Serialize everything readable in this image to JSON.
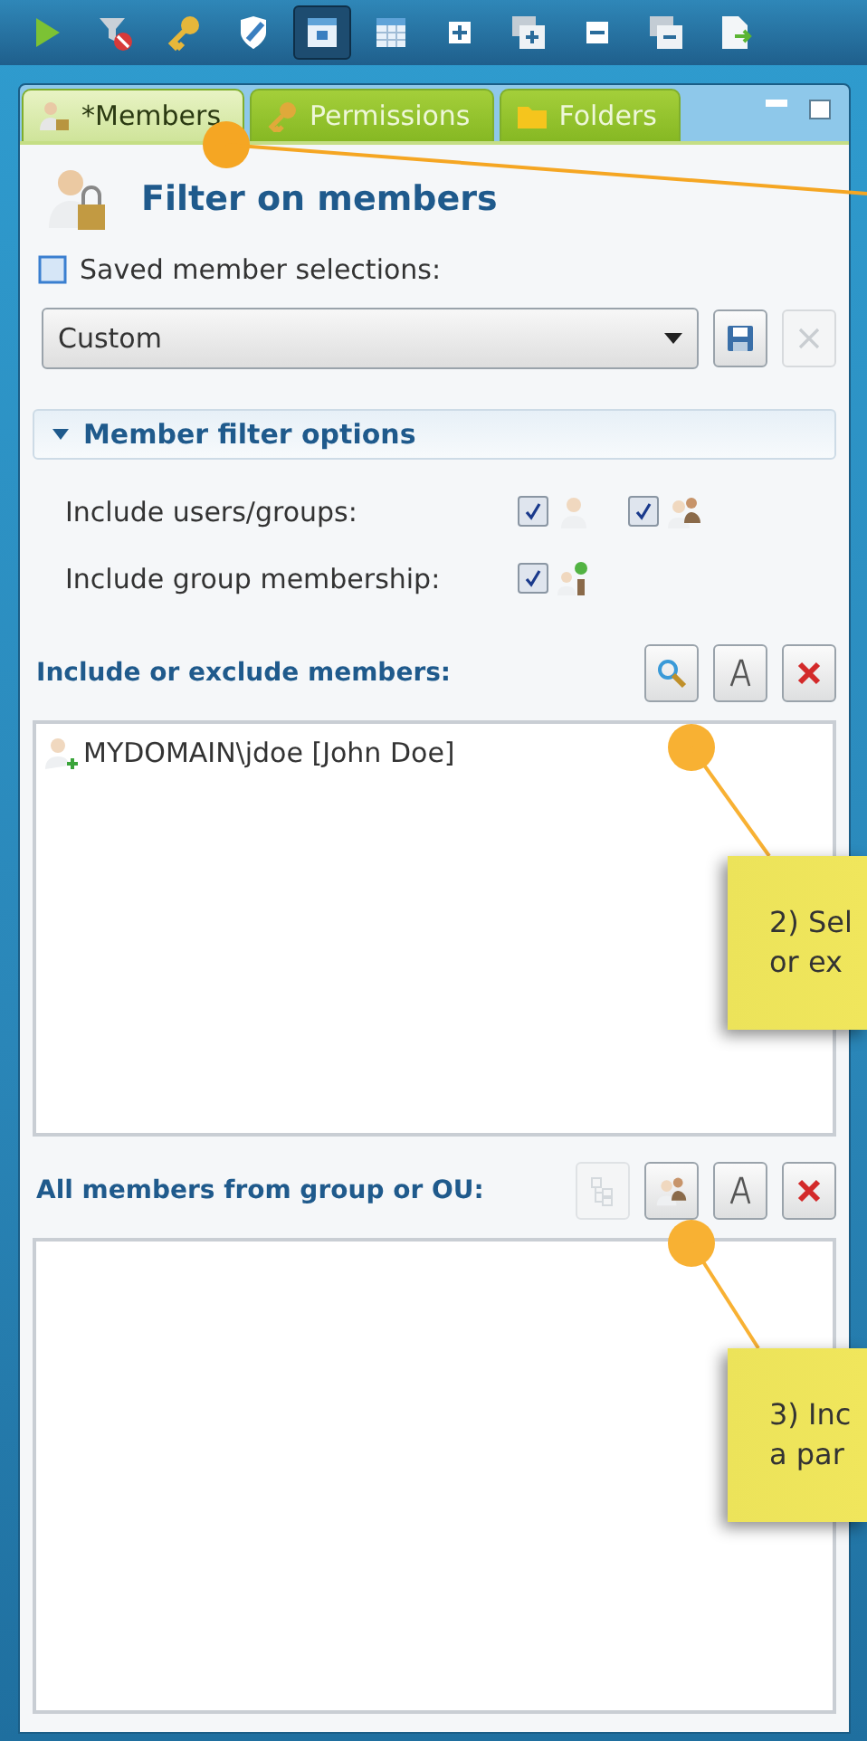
{
  "toolbar": {
    "buttons": [
      {
        "kind": "play",
        "selected": false
      },
      {
        "kind": "filter-off",
        "selected": false
      },
      {
        "kind": "key",
        "selected": false
      },
      {
        "kind": "shield",
        "selected": false
      },
      {
        "kind": "layout",
        "selected": true
      },
      {
        "kind": "table",
        "selected": false
      },
      {
        "kind": "plus",
        "selected": false
      },
      {
        "kind": "stack-plus",
        "selected": false
      },
      {
        "kind": "minus",
        "selected": false
      },
      {
        "kind": "stack-minus",
        "selected": false
      },
      {
        "kind": "export",
        "selected": false
      }
    ]
  },
  "tabs": [
    {
      "label": "*Members",
      "kind": "user",
      "selected": true
    },
    {
      "label": "Permissions",
      "kind": "key",
      "selected": false
    },
    {
      "label": "Folders",
      "kind": "folder",
      "selected": false
    }
  ],
  "heading": "Filter on members",
  "saved_selections": {
    "label": "Saved member selections:",
    "value": "Custom",
    "delete_disabled": true
  },
  "filter_options": {
    "title": "Member filter options",
    "expanded": true,
    "rows": [
      {
        "label": "Include users/groups:",
        "options": [
          {
            "kind": "user",
            "checked": true
          },
          {
            "kind": "group",
            "checked": true
          }
        ]
      },
      {
        "label": "Include group membership:",
        "options": [
          {
            "kind": "membership",
            "checked": true
          }
        ]
      }
    ]
  },
  "members_section": {
    "title": "Include or exclude members:",
    "actions": [
      {
        "kind": "search",
        "disabled": false
      },
      {
        "kind": "text",
        "disabled": false
      },
      {
        "kind": "remove",
        "disabled": false
      }
    ],
    "items": [
      "MYDOMAIN\\jdoe [John Doe]"
    ]
  },
  "group_section": {
    "title": "All members from group or OU:",
    "actions": [
      {
        "kind": "tree",
        "disabled": true
      },
      {
        "kind": "group",
        "disabled": false
      },
      {
        "kind": "text",
        "disabled": false
      },
      {
        "kind": "remove",
        "disabled": false
      }
    ]
  },
  "callouts": [
    {
      "lines": [
        "2) Sel",
        "or ex"
      ]
    },
    {
      "lines": [
        "3) Inc",
        "a par"
      ]
    }
  ]
}
